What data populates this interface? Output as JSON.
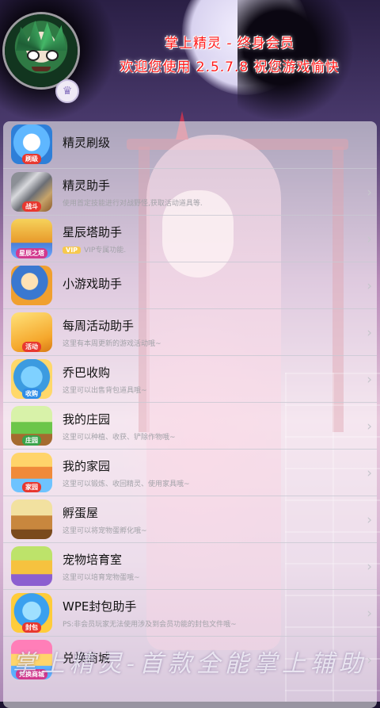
{
  "header": {
    "line1": "掌上精灵 - 终身会员",
    "line2": "欢迎您使用 2.5.7.8 祝您游戏愉快",
    "vip_icon": "crown-icon"
  },
  "menu": [
    {
      "title": "精灵刷级",
      "desc": "",
      "icon": "sprite-icon",
      "tag": "刷级"
    },
    {
      "title": "精灵助手",
      "desc": "使用首定技能进行对战野怪,获取活动道具等.",
      "icon": "sword-icon",
      "tag": "战斗"
    },
    {
      "title": "星辰塔助手",
      "desc": "VIP专属功能.",
      "icon": "tower-icon",
      "tag": "星辰之塔",
      "vip": "VIP"
    },
    {
      "title": "小游戏助手",
      "desc": "",
      "icon": "minigame-icon",
      "tag": ""
    },
    {
      "title": "每周活动助手",
      "desc": "这里有本周更新的游戏活动哦~",
      "icon": "weekly-event-icon",
      "tag": "活动"
    },
    {
      "title": "乔巴收购",
      "desc": "这里可以出售背包道具哦~",
      "icon": "qiaoba-icon",
      "tag": "收购"
    },
    {
      "title": "我的庄园",
      "desc": "这里可以种植、收获、铲除作物哦~",
      "icon": "farm-icon",
      "tag": "庄园"
    },
    {
      "title": "我的家园",
      "desc": "这里可以锻炼、收回精灵、使用家具哦~",
      "icon": "home-icon",
      "tag": "家园"
    },
    {
      "title": "孵蛋屋",
      "desc": "这里可以将宠物蛋孵化哦~",
      "icon": "egg-house-icon",
      "tag": ""
    },
    {
      "title": "宠物培育室",
      "desc": "这里可以培育宠物蛋哦~",
      "icon": "pet-nursery-icon",
      "tag": ""
    },
    {
      "title": "WPE封包助手",
      "desc": "PS:非会员玩家无法使用涉及到会员功能的封包文件哦~",
      "icon": "wpe-icon",
      "tag": "封包"
    },
    {
      "title": "兑换商城",
      "desc": "",
      "icon": "shop-icon",
      "tag": "兑换商城"
    }
  ],
  "watermark": "掌上精灵-首款全能掌上辅助",
  "colors": {
    "header_text": "#ff1a1a",
    "panel_bg": "rgba(255,255,255,0.55)",
    "title_text": "#111111",
    "desc_text": "#a2a2a8",
    "vip_pill": "#f7c94c"
  }
}
